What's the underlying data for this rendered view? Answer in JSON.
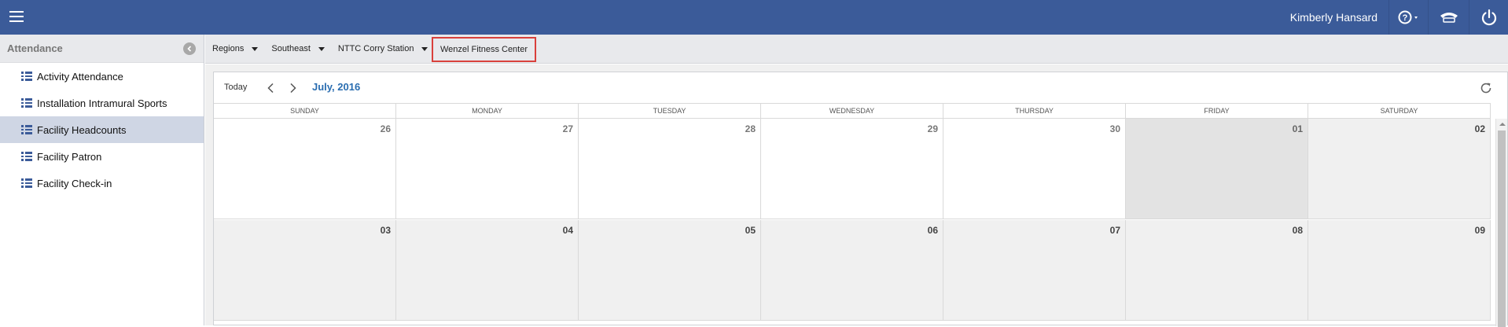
{
  "header": {
    "user_name": "Kimberly Hansard",
    "icons": [
      "menu-icon",
      "help-icon",
      "phone-icon",
      "power-icon"
    ],
    "color": "#3b5b99"
  },
  "sidebar": {
    "title": "Attendance",
    "items": [
      {
        "label": "Activity Attendance",
        "active": false
      },
      {
        "label": "Installation Intramural Sports",
        "active": false
      },
      {
        "label": "Facility Headcounts",
        "active": true
      },
      {
        "label": "Facility Patron",
        "active": false
      },
      {
        "label": "Facility Check-in",
        "active": false
      }
    ]
  },
  "breadcrumb": {
    "items": [
      "Regions",
      "Southeast",
      "NTTC Corry Station"
    ],
    "current": "Wenzel Fitness Center",
    "highlight_color": "#d9403b"
  },
  "calendar": {
    "today_label": "Today",
    "month_title": "July, 2016",
    "days_of_week": [
      "SUNDAY",
      "MONDAY",
      "TUESDAY",
      "WEDNESDAY",
      "THURSDAY",
      "FRIDAY",
      "SATURDAY"
    ],
    "weeks": [
      [
        "26",
        "27",
        "28",
        "29",
        "30",
        "01",
        "02"
      ],
      [
        "03",
        "04",
        "05",
        "06",
        "07",
        "08",
        "09"
      ]
    ],
    "accent_color": "#2a6db0"
  }
}
